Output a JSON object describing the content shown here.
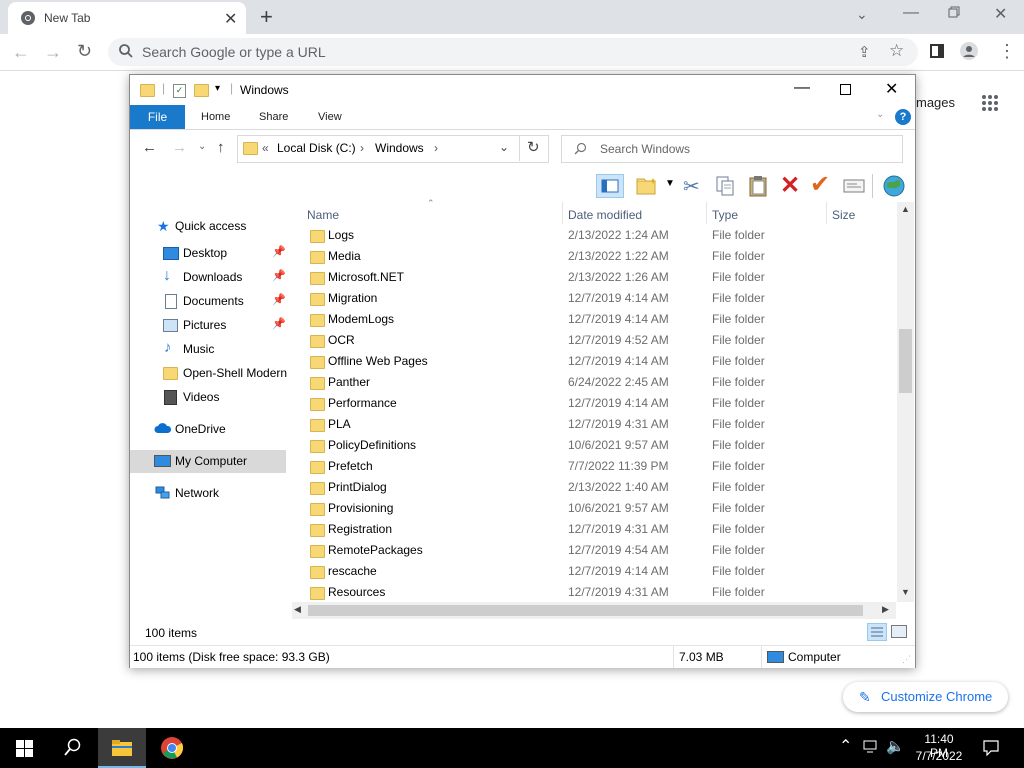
{
  "chrome": {
    "tab_title": "New Tab",
    "omnibox_placeholder": "Search Google or type a URL",
    "images_link": "mages",
    "customize_label": "Customize Chrome"
  },
  "explorer": {
    "title": "Windows",
    "ribbon_tabs": [
      "File",
      "Home",
      "Share",
      "View"
    ],
    "address": {
      "root": "Local Disk (C:)",
      "current": "Windows"
    },
    "search_placeholder": "Search Windows",
    "nav": {
      "quick_access": "Quick access",
      "pinned": [
        "Desktop",
        "Downloads",
        "Documents",
        "Pictures"
      ],
      "other": [
        "Music",
        "Open-Shell Modern",
        "Videos"
      ],
      "onedrive": "OneDrive",
      "my_computer": "My Computer",
      "network": "Network"
    },
    "columns": {
      "name": "Name",
      "date": "Date modified",
      "type": "Type",
      "size": "Size"
    },
    "files": [
      {
        "name": "Logs",
        "date": "2/13/2022 1:24 AM",
        "type": "File folder"
      },
      {
        "name": "Media",
        "date": "2/13/2022 1:22 AM",
        "type": "File folder"
      },
      {
        "name": "Microsoft.NET",
        "date": "2/13/2022 1:26 AM",
        "type": "File folder"
      },
      {
        "name": "Migration",
        "date": "12/7/2019 4:14 AM",
        "type": "File folder"
      },
      {
        "name": "ModemLogs",
        "date": "12/7/2019 4:14 AM",
        "type": "File folder"
      },
      {
        "name": "OCR",
        "date": "12/7/2019 4:52 AM",
        "type": "File folder"
      },
      {
        "name": "Offline Web Pages",
        "date": "12/7/2019 4:14 AM",
        "type": "File folder"
      },
      {
        "name": "Panther",
        "date": "6/24/2022 2:45 AM",
        "type": "File folder"
      },
      {
        "name": "Performance",
        "date": "12/7/2019 4:14 AM",
        "type": "File folder"
      },
      {
        "name": "PLA",
        "date": "12/7/2019 4:31 AM",
        "type": "File folder"
      },
      {
        "name": "PolicyDefinitions",
        "date": "10/6/2021 9:57 AM",
        "type": "File folder"
      },
      {
        "name": "Prefetch",
        "date": "7/7/2022 11:39 PM",
        "type": "File folder"
      },
      {
        "name": "PrintDialog",
        "date": "2/13/2022 1:40 AM",
        "type": "File folder"
      },
      {
        "name": "Provisioning",
        "date": "10/6/2021 9:57 AM",
        "type": "File folder"
      },
      {
        "name": "Registration",
        "date": "12/7/2019 4:31 AM",
        "type": "File folder"
      },
      {
        "name": "RemotePackages",
        "date": "12/7/2019 4:54 AM",
        "type": "File folder"
      },
      {
        "name": "rescache",
        "date": "12/7/2019 4:14 AM",
        "type": "File folder"
      },
      {
        "name": "Resources",
        "date": "12/7/2019 4:31 AM",
        "type": "File folder"
      }
    ],
    "item_count": "100 items",
    "status_left": "100 items (Disk free space: 93.3 GB)",
    "status_size": "7.03 MB",
    "status_location": "Computer"
  },
  "taskbar": {
    "time": "11:40 PM",
    "date": "7/7/2022"
  }
}
